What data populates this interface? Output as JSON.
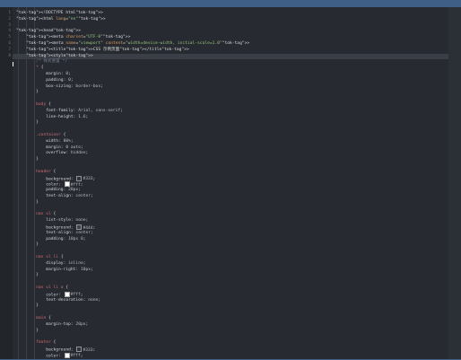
{
  "editor": {
    "lines": [
      "<!DOCTYPE html>",
      "<html lang=\"en\">",
      "",
      "<head>",
      "    <meta charset=\"UTF-8\">",
      "    <meta name=\"viewport\" content=\"width=device-width, initial-scale=1.0\">",
      "    <title>CSS 示例页面</title>",
      "    <style>",
      "        /* 样式重置 */",
      "        * {",
      "            margin: 0;",
      "            padding: 0;",
      "            box-sizing: border-box;",
      "        }",
      "",
      "        body {",
      "            font-family: Arial, sans-serif;",
      "            line-height: 1.6;",
      "        }",
      "",
      "        .container {",
      "            width: 80%;",
      "            margin: 0 auto;",
      "            overflow: hidden;",
      "        }",
      "",
      "        header {",
      "            background: #333;",
      "            color: #fff;",
      "            padding: 20px;",
      "            text-align: center;",
      "        }",
      "",
      "        nav ul {",
      "            list-style: none;",
      "            background: #444;",
      "            text-align: center;",
      "            padding: 10px 0;",
      "        }",
      "",
      "        nav ul li {",
      "            display: inline;",
      "            margin-right: 10px;",
      "        }",
      "",
      "        nav ul li a {",
      "            color: #fff;",
      "            text-decoration: none;",
      "        }",
      "",
      "        main {",
      "            margin-top: 20px;",
      "        }",
      "",
      "        footer {",
      "            background: #333;",
      "            color: #fff;"
    ],
    "line_numbers": [
      "1",
      "2",
      "3",
      "4",
      "5",
      "6",
      "7",
      "8"
    ],
    "active_line": 8
  }
}
